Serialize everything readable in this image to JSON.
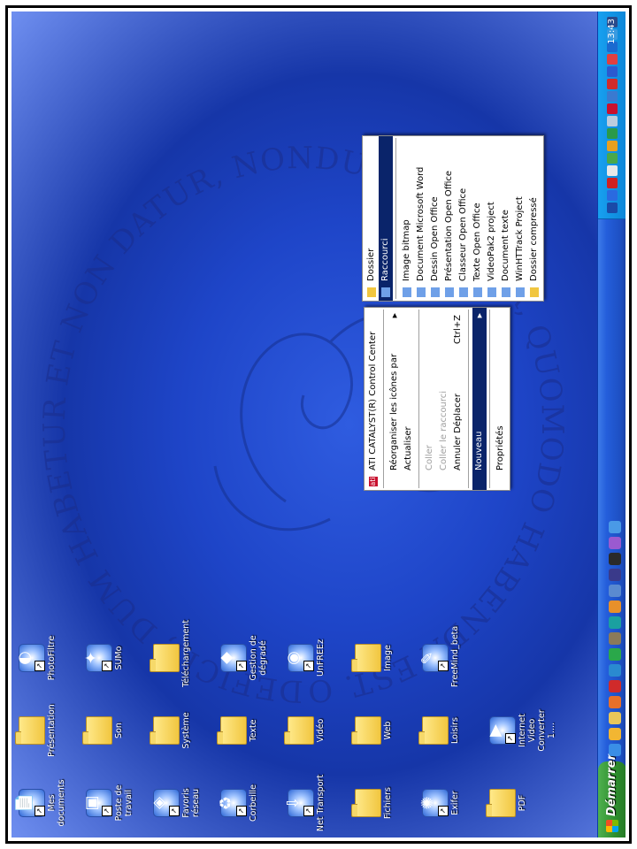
{
  "desktop": {
    "motto": "DEFICIT, DUM HABETUR ET NON DATUR, NONDUM HABETUR, QUOMODO HABENDA EST. OMNIS ENIM RES, QUAE DANDO",
    "icons": [
      {
        "label": "Mes documents",
        "icon": "my-documents-icon"
      },
      {
        "label": "Présentation",
        "icon": "folder-icon"
      },
      {
        "label": "PhotoFiltre",
        "icon": "photofiltre-icon"
      },
      {
        "label": "Poste de travail",
        "icon": "my-computer-icon"
      },
      {
        "label": "Son",
        "icon": "folder-icon"
      },
      {
        "label": "SUMo",
        "icon": "sumo-icon"
      },
      {
        "label": "Favoris réseau",
        "icon": "network-places-icon"
      },
      {
        "label": "Système",
        "icon": "folder-icon"
      },
      {
        "label": "Téléchargement",
        "icon": "folder-icon"
      },
      {
        "label": "Corbeille",
        "icon": "recycle-bin-icon"
      },
      {
        "label": "Texte",
        "icon": "folder-icon"
      },
      {
        "label": "Gestion de dégradé",
        "icon": "gradient-tool-icon"
      },
      {
        "label": "Net Transport",
        "icon": "net-transport-icon"
      },
      {
        "label": "Vidéo",
        "icon": "folder-icon"
      },
      {
        "label": "UnFREEz",
        "icon": "unfreez-icon"
      },
      {
        "label": "Fichiers",
        "icon": "folder-icon"
      },
      {
        "label": "Web",
        "icon": "folder-icon"
      },
      {
        "label": "Image",
        "icon": "folder-icon"
      },
      {
        "label": "Exifer",
        "icon": "exifer-icon"
      },
      {
        "label": "Loisirs",
        "icon": "folder-icon"
      },
      {
        "label": "FreeMind_beta",
        "icon": "freemind-icon"
      },
      {
        "label": "PDF",
        "icon": "folder-icon"
      },
      {
        "label": "Internet Video Converter 1....",
        "icon": "video-converter-icon"
      }
    ]
  },
  "context_menu": {
    "items": [
      {
        "label": "ATI CATALYST(R) Control Center",
        "icon": "ati-icon",
        "accel": "",
        "arrow": false,
        "disabled": false,
        "selected": false
      },
      {
        "sep": true
      },
      {
        "label": "Réorganiser les icônes par",
        "accel": "",
        "arrow": true,
        "disabled": false,
        "selected": false
      },
      {
        "label": "Actualiser",
        "accel": "",
        "arrow": false,
        "disabled": false,
        "selected": false
      },
      {
        "sep": true
      },
      {
        "label": "Coller",
        "accel": "",
        "arrow": false,
        "disabled": true,
        "selected": false
      },
      {
        "label": "Coller le raccourci",
        "accel": "",
        "arrow": false,
        "disabled": true,
        "selected": false
      },
      {
        "label": "Annuler Déplacer",
        "accel": "Ctrl+Z",
        "arrow": false,
        "disabled": false,
        "selected": false
      },
      {
        "sep": true
      },
      {
        "label": "Nouveau",
        "accel": "",
        "arrow": true,
        "disabled": false,
        "selected": true
      },
      {
        "sep": true
      },
      {
        "label": "Propriétés",
        "accel": "",
        "arrow": false,
        "disabled": false,
        "selected": false
      }
    ]
  },
  "submenu": {
    "items": [
      {
        "label": "Dossier",
        "icon": "folder-icon",
        "selected": false
      },
      {
        "label": "Raccourci",
        "icon": "shortcut-icon",
        "selected": true
      },
      {
        "sep": true
      },
      {
        "label": "Image bitmap",
        "icon": "bitmap-icon",
        "selected": false
      },
      {
        "label": "Document Microsoft Word",
        "icon": "word-icon",
        "selected": false
      },
      {
        "label": "Dessin Open Office",
        "icon": "oo-draw-icon",
        "selected": false
      },
      {
        "label": "Présentation Open Office",
        "icon": "oo-impress-icon",
        "selected": false
      },
      {
        "label": "Classeur Open Office",
        "icon": "oo-calc-icon",
        "selected": false
      },
      {
        "label": "Texte Open Office",
        "icon": "oo-writer-icon",
        "selected": false
      },
      {
        "label": "VideoPak2 project",
        "icon": "videopak-icon",
        "selected": false
      },
      {
        "label": "Document texte",
        "icon": "text-document-icon",
        "selected": false
      },
      {
        "label": "WinHTTrack Project",
        "icon": "winhttrack-icon",
        "selected": false
      },
      {
        "label": "Dossier compressé",
        "icon": "zip-folder-icon",
        "selected": false
      }
    ]
  },
  "taskbar": {
    "start_label": "Démarrer",
    "clock": "13:43",
    "quick_launch": [
      "ie-icon",
      "outlook-icon",
      "folder-icon",
      "firefox-icon",
      "opera-icon",
      "thunderbird-icon",
      "media-icon",
      "gimp-icon",
      "player-icon",
      "winamp-icon",
      "desktop-icon",
      "film-icon",
      "terminal-icon",
      "music-icon",
      "clipboard-icon"
    ],
    "tray": [
      "fr-lang-icon",
      "speaker-icon",
      "network-icon",
      "antivirus-icon",
      "update-icon",
      "sync-icon",
      "messenger-icon",
      "battery-icon",
      "printer-icon",
      "shield-icon",
      "bluetooth-icon",
      "security-icon",
      "ati-tray-icon",
      "info-icon",
      "wifi-icon",
      "power-icon"
    ],
    "colors": {
      "start": "#2e8f2e",
      "bar": "#245edb",
      "tray": "#0c86d8"
    }
  }
}
